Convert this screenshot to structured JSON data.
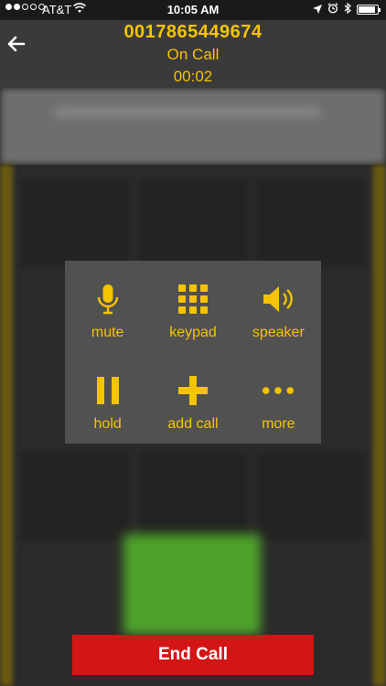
{
  "status_bar": {
    "signal_dots_filled": 2,
    "signal_dots_total": 5,
    "carrier": "AT&T",
    "time": "10:05 AM",
    "icons": [
      "wifi-icon",
      "location-icon",
      "alarm-icon",
      "bluetooth-icon",
      "battery-icon"
    ],
    "battery_level": 0.9
  },
  "header": {
    "back_icon": "arrow-left-icon",
    "phone_number": "0017865449674",
    "call_state": "On Call",
    "call_timer": "00:02"
  },
  "controls": {
    "mute_label": "mute",
    "keypad_label": "keypad",
    "speaker_label": "speaker",
    "hold_label": "hold",
    "add_call_label": "add call",
    "more_label": "more"
  },
  "end_call": {
    "label": "End Call"
  },
  "colors": {
    "accent": "#f5c400",
    "end_call": "#d31515",
    "header_bg": "#3a3a3a",
    "panel_bg": "#555555"
  }
}
